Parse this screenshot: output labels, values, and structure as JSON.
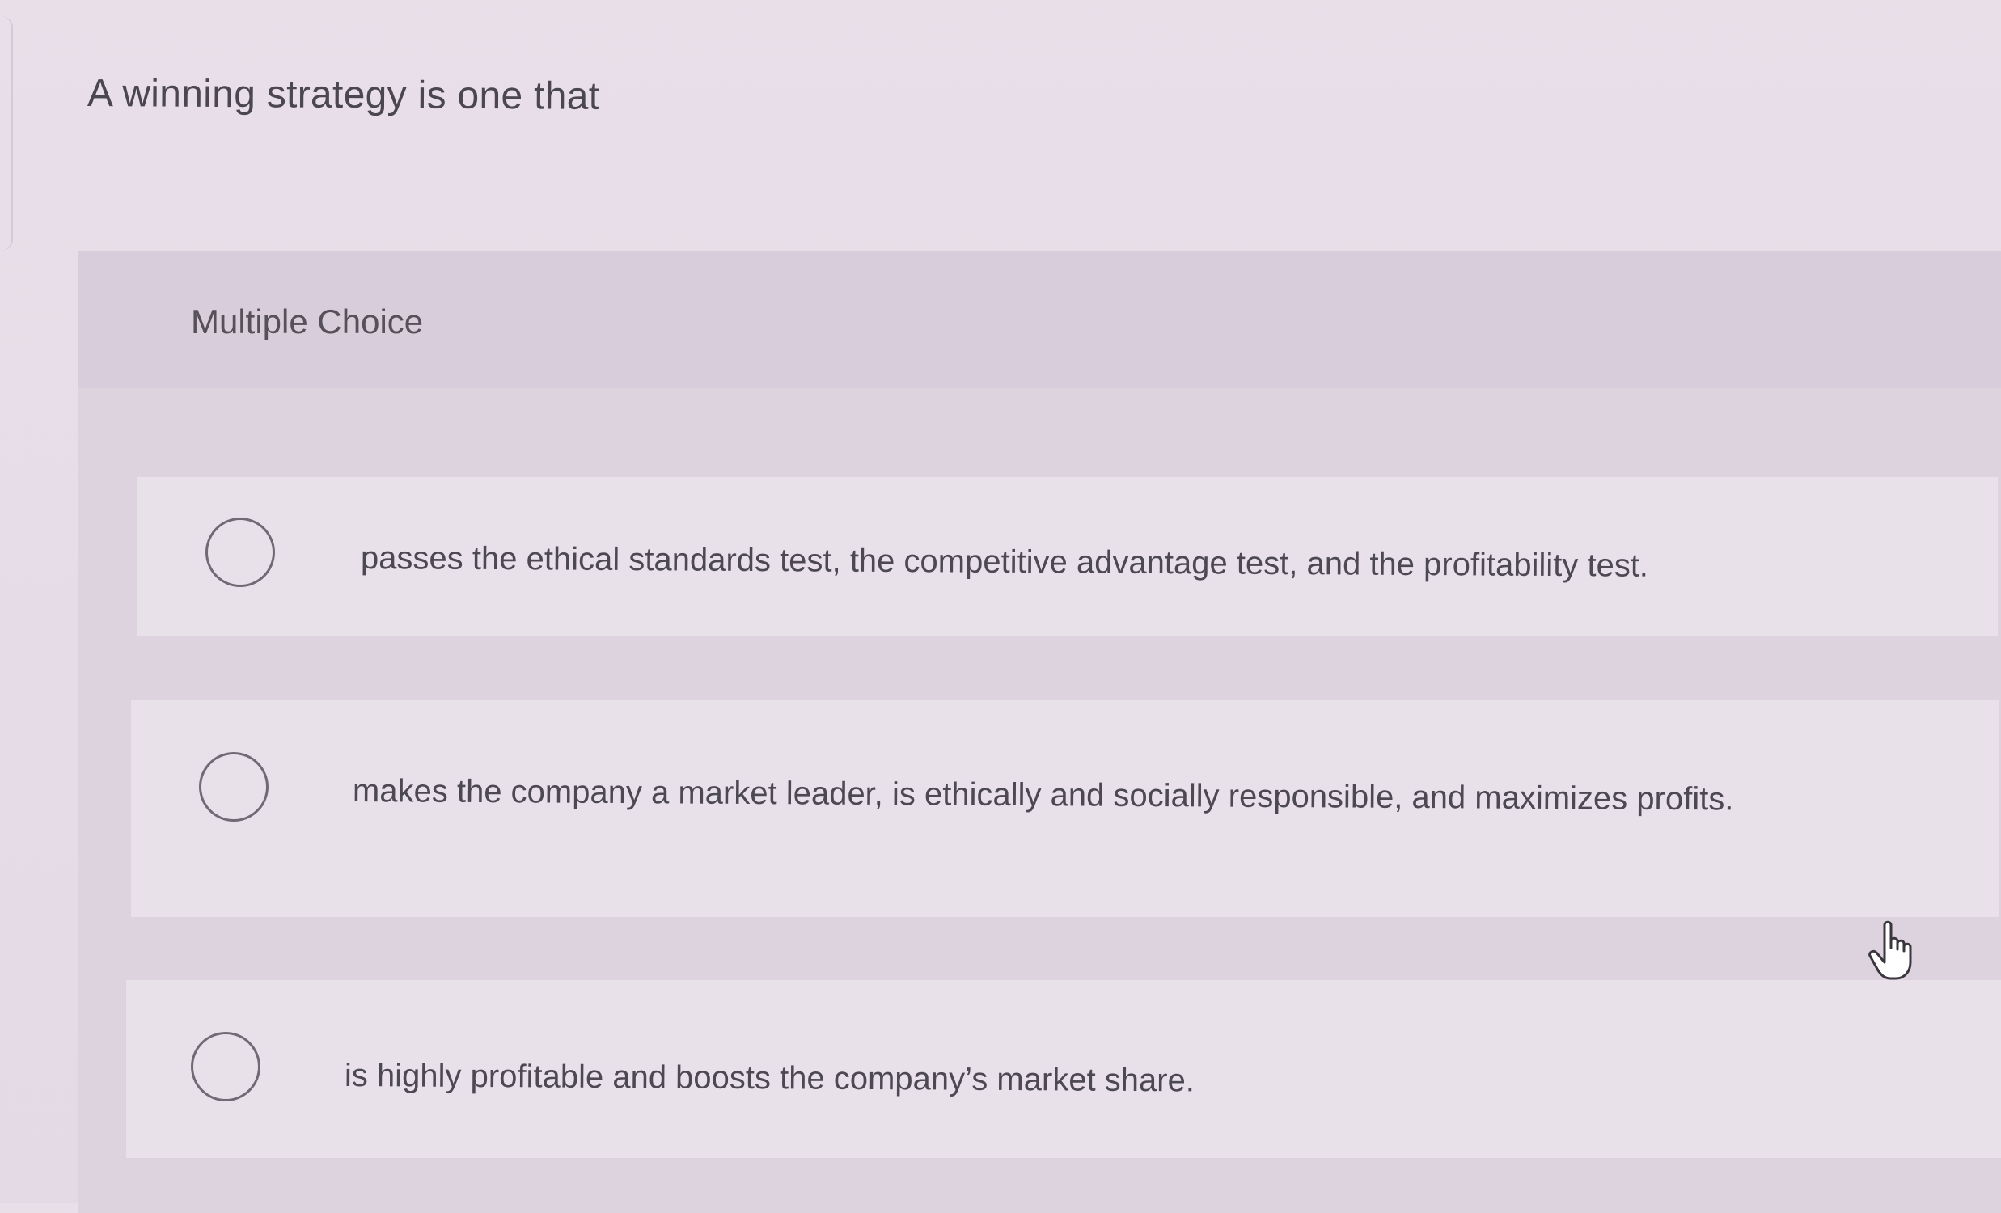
{
  "question": {
    "text": "A winning strategy is one that"
  },
  "multiple_choice": {
    "title": "Multiple Choice",
    "options": [
      {
        "label": "passes the ethical standards test, the competitive advantage test, and the profitability test.",
        "selected": false
      },
      {
        "label": "makes the company a market leader, is ethically and socially responsible, and maximizes profits.",
        "selected": false
      },
      {
        "label": "is highly profitable and boosts the company’s market share.",
        "selected": false
      }
    ]
  },
  "icons": {
    "radio": "radio-button-unselected-icon",
    "cursor": "hand-pointer-cursor-icon"
  },
  "colors": {
    "background": "#e6dde8",
    "panel": "#ddd3df",
    "option_background": "#e8e1ea",
    "text": "#4d4952",
    "radio_border": "#6f6a74"
  }
}
